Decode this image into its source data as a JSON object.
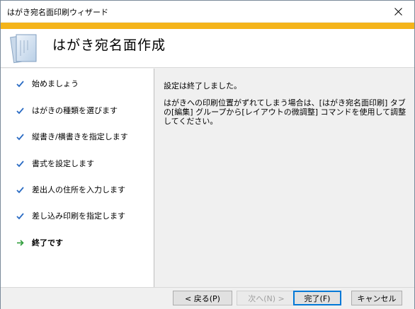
{
  "window": {
    "title": "はがき宛名面印刷ウィザード"
  },
  "header": {
    "title": "はがき宛名面作成"
  },
  "steps": [
    {
      "label": "始めましょう",
      "state": "done"
    },
    {
      "label": "はがきの種類を選びます",
      "state": "done"
    },
    {
      "label": "縦書き/横書きを指定します",
      "state": "done"
    },
    {
      "label": "書式を設定します",
      "state": "done"
    },
    {
      "label": "差出人の住所を入力します",
      "state": "done"
    },
    {
      "label": "差し込み印刷を指定します",
      "state": "done"
    },
    {
      "label": "終了です",
      "state": "current"
    }
  ],
  "content": {
    "message1": "設定は終了しました。",
    "message2": "はがきへの印刷位置がずれてしまう場合は、[はがき宛名面印刷] タブの[編集] グループから[レイアウトの微調整] コマンドを使用して調整してください。"
  },
  "buttons": {
    "back": "< 戻る(P)",
    "next": "次へ(N) >",
    "finish": "完了(F)",
    "cancel": "キャンセル"
  },
  "colors": {
    "accent_stripe": "#f4b41a",
    "check_done": "#2b6cc4",
    "arrow_current": "#2e9d3a",
    "default_button_border": "#0078d7"
  },
  "icons": {
    "done": "check-icon",
    "current": "arrow-right-icon",
    "close": "close-icon",
    "header": "document-icon"
  }
}
